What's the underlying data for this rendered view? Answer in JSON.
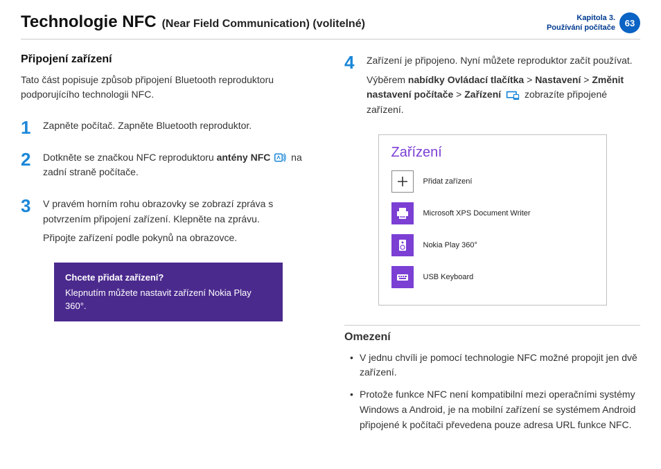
{
  "header": {
    "title": "Technologie NFC",
    "subtitle": "(Near Field Communication) (volitelné)",
    "chapter_line1": "Kapitola 3.",
    "chapter_line2": "Používání počítače",
    "page_number": "63"
  },
  "left": {
    "section_title": "Připojení zařízení",
    "intro": "Tato část popisuje způsob připojení Bluetooth reproduktoru podporujícího technologii NFC.",
    "steps": [
      {
        "num": "1",
        "lines": [
          "Zapněte počítač. Zapněte Bluetooth reproduktor."
        ]
      },
      {
        "num": "2",
        "pre": "Dotkněte se značkou NFC reproduktoru ",
        "bold": "antény NFC",
        "post": " na zadní straně počítače."
      },
      {
        "num": "3",
        "lines": [
          "V pravém horním rohu obrazovky se zobrazí zpráva s potvrzením připojení zařízení. Klepněte na zprávu.",
          "Připojte zařízení podle pokynů na obrazovce."
        ]
      }
    ],
    "popup": {
      "title": "Chcete přidat zařízení?",
      "body": "Klepnutím můžete nastavit zařízení Nokia Play 360°."
    }
  },
  "right": {
    "step4": {
      "num": "4",
      "line1": "Zařízení je připojeno. Nyní můžete reproduktor začít používat.",
      "pre": "Výběrem ",
      "bold1": "nabídky Ovládací tlačítka",
      "gt1": " > ",
      "bold2": "Nastavení",
      "gt2": " > ",
      "bold3": "Změnit nastavení počítače",
      "gt3": " > ",
      "bold4": "Zařízení",
      "post": " zobrazíte připojené zařízení."
    },
    "devices_panel": {
      "title": "Zařízení",
      "items": [
        {
          "icon": "plus",
          "label": "Přidat zařízení"
        },
        {
          "icon": "printer",
          "label": "Microsoft XPS Document Writer"
        },
        {
          "icon": "speaker",
          "label": "Nokia Play 360°"
        },
        {
          "icon": "keyboard",
          "label": "USB Keyboard"
        }
      ]
    },
    "limitations_title": "Omezení",
    "limitations": [
      "V jednu chvíli je pomocí technologie NFC možné propojit jen dvě zařízení.",
      "Protože funkce NFC není kompatibilní mezi operačními systémy Windows a Android, je na mobilní zařízení se systémem Android připojené k počítači převedena pouze adresa URL funkce NFC."
    ]
  }
}
